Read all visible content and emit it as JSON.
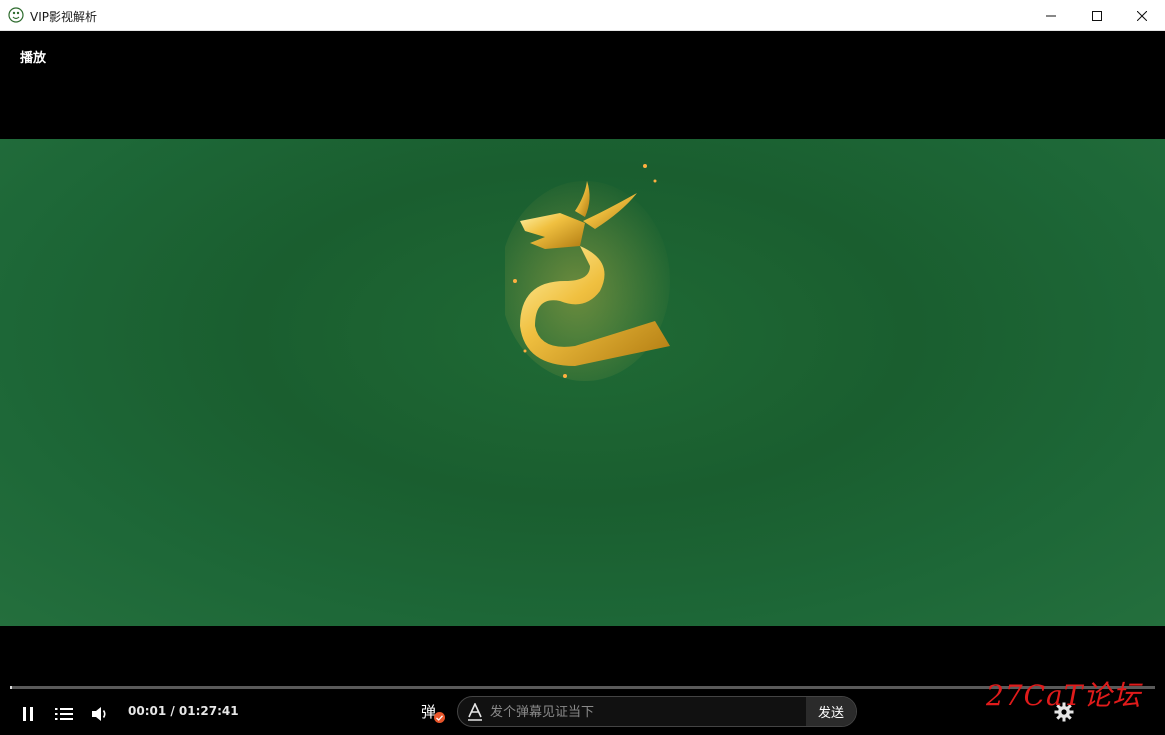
{
  "window": {
    "title": "VIP影视解析",
    "icon": "app-logo-icon"
  },
  "player": {
    "top_label": "播放",
    "video_colors": {
      "background": "#1c6333"
    },
    "progress": {
      "played_fraction": 0.0002
    },
    "time_display": "00:01 / 01:27:41",
    "danmu": {
      "toggle_label": "弹",
      "placeholder": "发个弹幕见证当下",
      "send_label": "发送"
    },
    "watermark": "27CaT论坛"
  },
  "colors": {
    "accent": "#e8552a",
    "watermark": "#e01b1b"
  }
}
